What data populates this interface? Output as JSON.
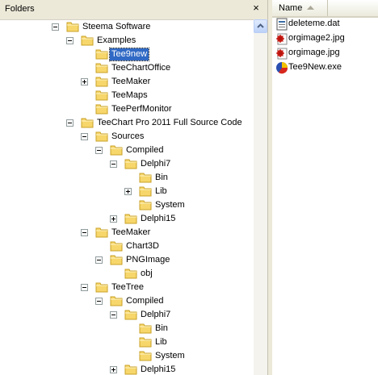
{
  "folders_pane": {
    "title": "Folders",
    "close_glyph": "×",
    "tree": [
      {
        "label": "Steema Software",
        "depth": 0,
        "expander": "minus"
      },
      {
        "label": "Examples",
        "depth": 1,
        "expander": "minus"
      },
      {
        "label": "Tee9new",
        "depth": 2,
        "expander": "none",
        "selected": true
      },
      {
        "label": "TeeChartOffice",
        "depth": 2,
        "expander": "none"
      },
      {
        "label": "TeeMaker",
        "depth": 2,
        "expander": "plus"
      },
      {
        "label": "TeeMaps",
        "depth": 2,
        "expander": "none"
      },
      {
        "label": "TeePerfMonitor",
        "depth": 2,
        "expander": "none"
      },
      {
        "label": "TeeChart Pro 2011 Full Source Code",
        "depth": 1,
        "expander": "minus"
      },
      {
        "label": "Sources",
        "depth": 2,
        "expander": "minus"
      },
      {
        "label": "Compiled",
        "depth": 3,
        "expander": "minus"
      },
      {
        "label": "Delphi7",
        "depth": 4,
        "expander": "minus"
      },
      {
        "label": "Bin",
        "depth": 5,
        "expander": "none"
      },
      {
        "label": "Lib",
        "depth": 5,
        "expander": "plus"
      },
      {
        "label": "System",
        "depth": 5,
        "expander": "none"
      },
      {
        "label": "Delphi15",
        "depth": 4,
        "expander": "plus"
      },
      {
        "label": "TeeMaker",
        "depth": 2,
        "expander": "minus"
      },
      {
        "label": "Chart3D",
        "depth": 3,
        "expander": "none"
      },
      {
        "label": "PNGImage",
        "depth": 3,
        "expander": "minus"
      },
      {
        "label": "obj",
        "depth": 4,
        "expander": "none"
      },
      {
        "label": "TeeTree",
        "depth": 2,
        "expander": "minus"
      },
      {
        "label": "Compiled",
        "depth": 3,
        "expander": "minus"
      },
      {
        "label": "Delphi7",
        "depth": 4,
        "expander": "minus"
      },
      {
        "label": "Bin",
        "depth": 5,
        "expander": "none"
      },
      {
        "label": "Lib",
        "depth": 5,
        "expander": "none"
      },
      {
        "label": "System",
        "depth": 5,
        "expander": "none"
      },
      {
        "label": "Delphi15",
        "depth": 4,
        "expander": "plus"
      }
    ]
  },
  "file_list": {
    "column_name": "Name",
    "sort": "ascending",
    "files": [
      {
        "name": "deleteme.dat",
        "icon": "data-file-icon"
      },
      {
        "name": "orgimage2.jpg",
        "icon": "jpg-image-icon"
      },
      {
        "name": "orgimage.jpg",
        "icon": "jpg-image-icon"
      },
      {
        "name": "Tee9New.exe",
        "icon": "exe-app-icon"
      }
    ]
  },
  "colors": {
    "selection": "#316ac5",
    "folder_fill": "#f7d76b",
    "folder_stroke": "#c9a227",
    "toolbar_bg": "#ece9d8"
  }
}
